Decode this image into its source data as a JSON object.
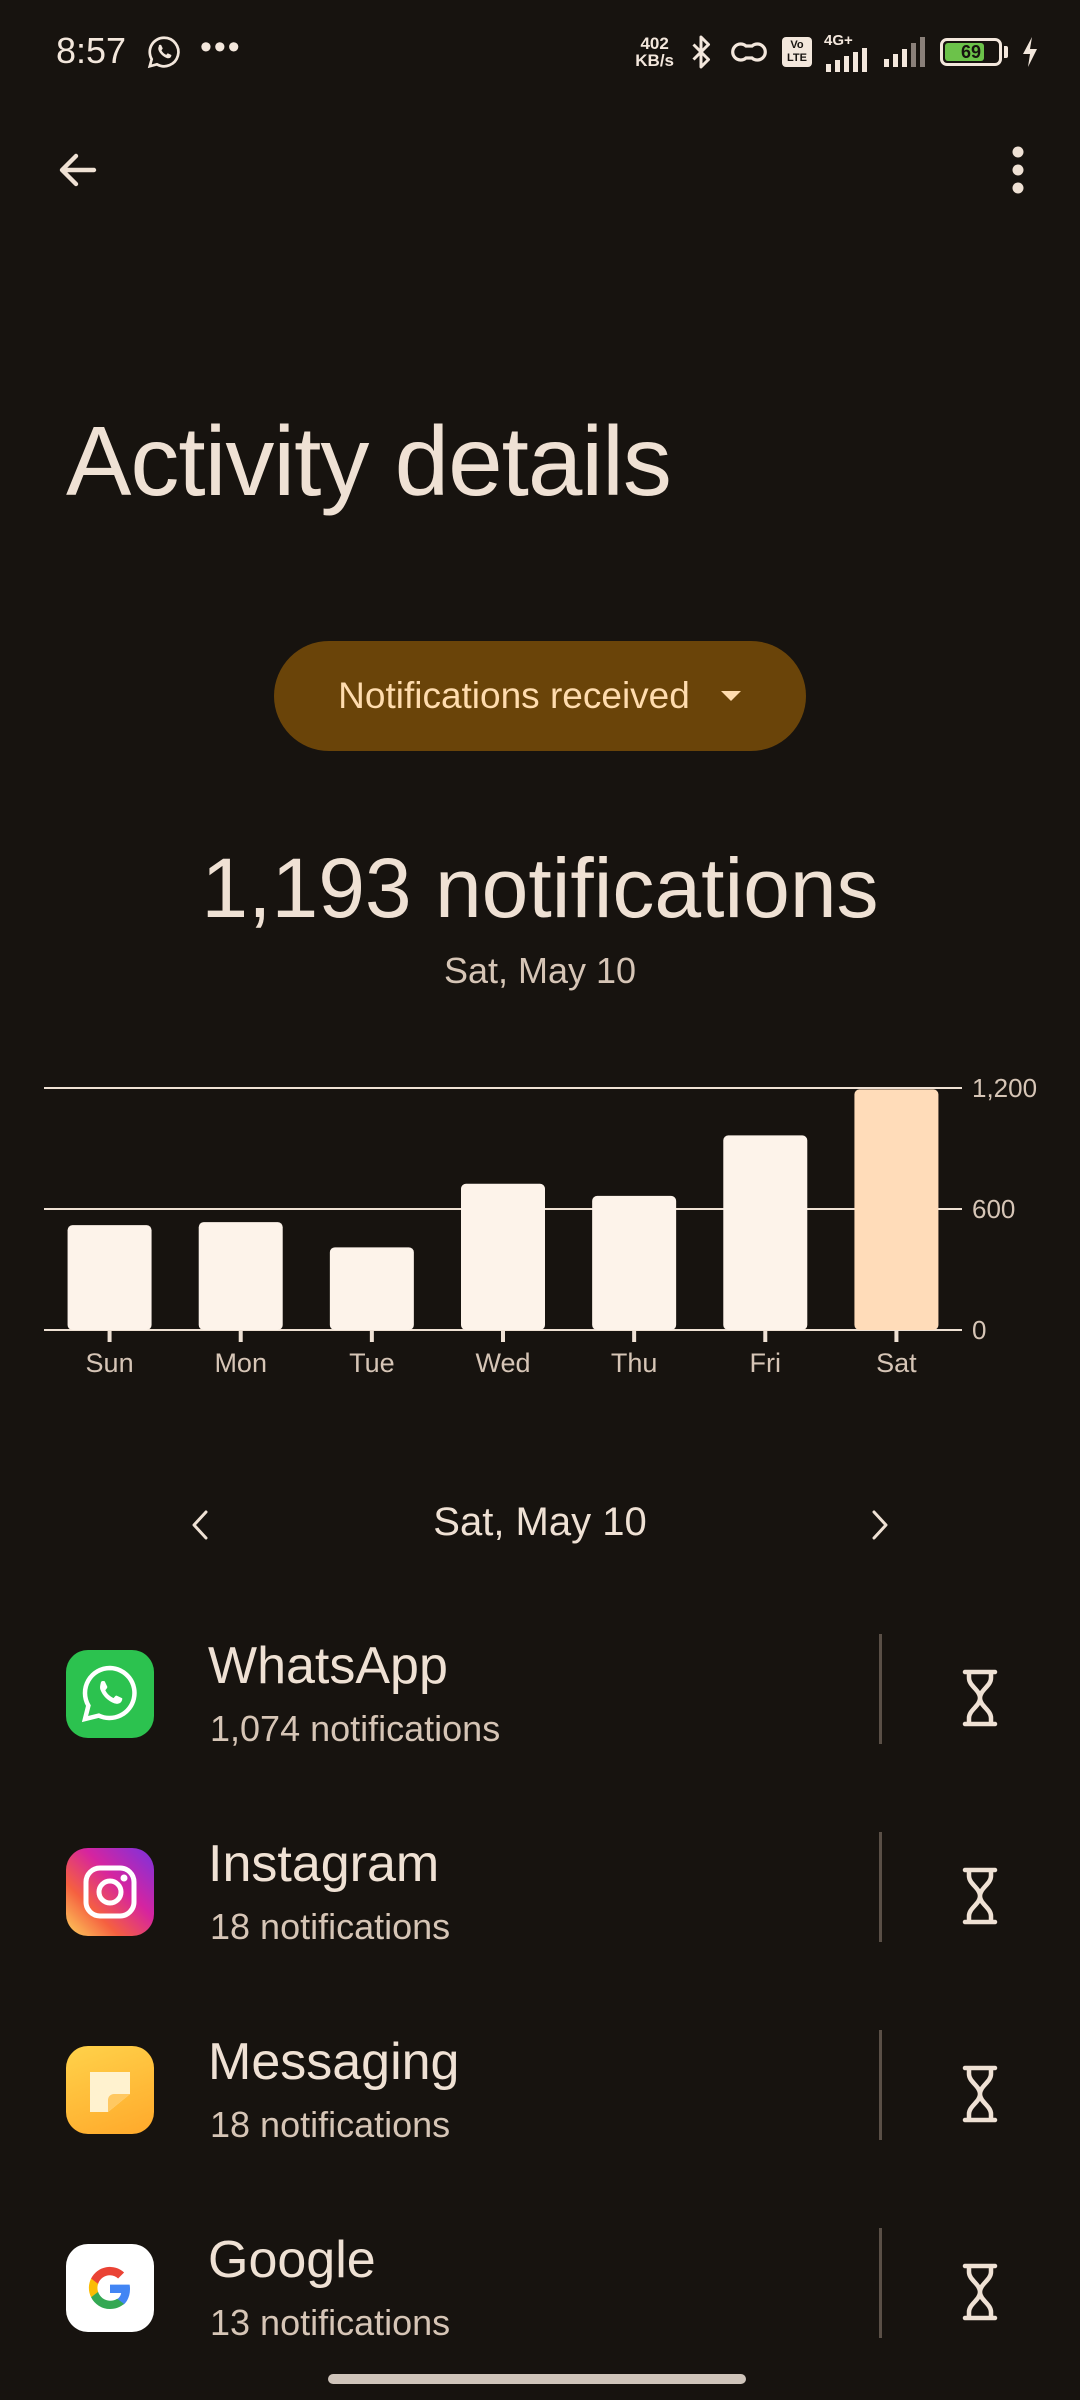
{
  "status_bar": {
    "time": "8:57",
    "more": "•••",
    "net_speed_value": "402",
    "net_speed_unit": "KB/s",
    "network": "4G+",
    "battery": "69",
    "icons": [
      "whatsapp-icon",
      "bluetooth-icon",
      "link-icon",
      "volte-icon",
      "signal-icon",
      "signal-icon",
      "battery-icon",
      "charging-icon"
    ]
  },
  "header": {
    "title": "Activity details",
    "back_icon": "arrow-back-icon",
    "more_icon": "more-vert-icon"
  },
  "metric_selector": {
    "label": "Notifications received",
    "icon": "dropdown-arrow-icon"
  },
  "summary": {
    "count": "1,193 notifications",
    "date": "Sat, May 10"
  },
  "chart_data": {
    "type": "bar",
    "categories": [
      "Sun",
      "Mon",
      "Tue",
      "Wed",
      "Thu",
      "Fri",
      "Sat"
    ],
    "values": [
      520,
      535,
      410,
      725,
      665,
      965,
      1193
    ],
    "ylim": [
      0,
      1200
    ],
    "yticks": [
      "1,200",
      "600",
      "0"
    ],
    "selected_category": "Sat",
    "colors": {
      "bar": "#fdf3ea",
      "selected_bar": "#ffdcb9",
      "grid": "#efe1d4"
    },
    "grid": true
  },
  "day_nav": {
    "label": "Sat, May 10",
    "prev_icon": "chevron-left-icon",
    "next_icon": "chevron-right-icon"
  },
  "apps": [
    {
      "name": "WhatsApp",
      "count": "1,074 notifications",
      "icon": "whatsapp-icon"
    },
    {
      "name": "Instagram",
      "count": "18 notifications",
      "icon": "instagram-icon"
    },
    {
      "name": "Messaging",
      "count": "18 notifications",
      "icon": "messaging-icon"
    },
    {
      "name": "Google",
      "count": "13 notifications",
      "icon": "google-icon"
    }
  ],
  "timer_icon": "hourglass-icon"
}
